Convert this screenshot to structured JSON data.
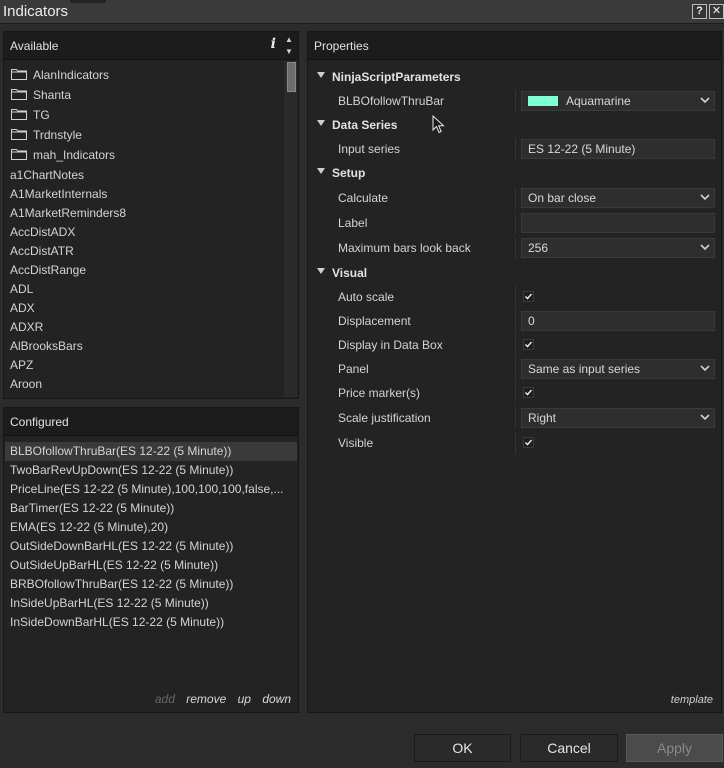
{
  "window": {
    "title": "Indicators",
    "help_label": "?",
    "close_label": "✕"
  },
  "available": {
    "header": "Available",
    "info_label": "i",
    "folders": [
      "AlanIndicators",
      "Shanta",
      "TG",
      "Trdnstyle",
      "mah_Indicators"
    ],
    "items": [
      "a1ChartNotes",
      "A1MarketInternals",
      "A1MarketReminders8",
      "AccDistADX",
      "AccDistATR",
      "AccDistRange",
      "ADL",
      "ADX",
      "ADXR",
      "AlBrooksBars",
      "APZ",
      "Aroon"
    ]
  },
  "configured": {
    "header": "Configured",
    "items": [
      "BLBOfollowThruBar(ES 12-22 (5 Minute))",
      "TwoBarRevUpDown(ES 12-22 (5 Minute))",
      "PriceLine(ES 12-22 (5 Minute),100,100,100,false,...",
      "BarTimer(ES 12-22 (5 Minute))",
      "EMA(ES 12-22 (5 Minute),20)",
      "OutSideDownBarHL(ES 12-22 (5 Minute))",
      "OutSideUpBarHL(ES 12-22 (5 Minute))",
      "BRBOfollowThruBar(ES 12-22 (5 Minute))",
      "InSideUpBarHL(ES 12-22 (5 Minute))",
      "InSideDownBarHL(ES 12-22 (5 Minute))"
    ],
    "actions": {
      "add": "add",
      "remove": "remove",
      "up": "up",
      "down": "down"
    }
  },
  "properties": {
    "header": "Properties",
    "template_label": "template",
    "categories": {
      "ninjascript": "NinjaScriptParameters",
      "data_series": "Data Series",
      "setup": "Setup",
      "visual": "Visual"
    },
    "rows": {
      "blbo": {
        "label": "BLBOfollowThruBar",
        "value": "Aquamarine",
        "swatch_color": "#7fffd4"
      },
      "input_series": {
        "label": "Input series",
        "value": "ES 12-22 (5 Minute)"
      },
      "calculate": {
        "label": "Calculate",
        "value": "On bar close"
      },
      "label": {
        "label": "Label",
        "value": ""
      },
      "max_bars": {
        "label": "Maximum bars look back",
        "value": "256"
      },
      "auto_scale": {
        "label": "Auto scale",
        "checked": true
      },
      "displacement": {
        "label": "Displacement",
        "value": "0"
      },
      "data_box": {
        "label": "Display in Data Box",
        "checked": true
      },
      "panel": {
        "label": "Panel",
        "value": "Same as input series"
      },
      "price_marker": {
        "label": "Price marker(s)",
        "checked": true
      },
      "scale_just": {
        "label": "Scale justification",
        "value": "Right"
      },
      "visible": {
        "label": "Visible",
        "checked": true
      }
    }
  },
  "buttons": {
    "ok": "OK",
    "cancel": "Cancel",
    "apply": "Apply"
  }
}
